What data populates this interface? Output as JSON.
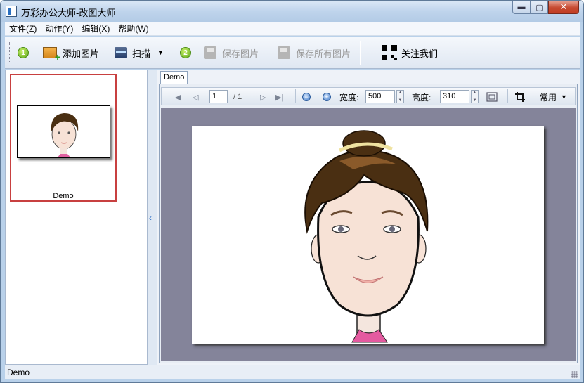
{
  "window": {
    "title": "万彩办公大师-改图大师",
    "buttons": {
      "minimize": "▬",
      "maximize": "▢",
      "close": "✕"
    }
  },
  "menu": {
    "items": [
      "文件(Z)",
      "动作(Y)",
      "编辑(X)",
      "帮助(W)"
    ]
  },
  "toolbar": {
    "step1": "1",
    "add_image": "添加图片",
    "scan": "扫描",
    "step2": "2",
    "save_image": "保存图片",
    "save_all": "保存所有图片",
    "follow_us": "关注我们"
  },
  "thumbnails": [
    {
      "label": "Demo",
      "selected": true
    }
  ],
  "tab": {
    "label": "Demo"
  },
  "viewer": {
    "page_current": "1",
    "page_total": "/ 1",
    "width_label": "宽度:",
    "width_value": "500",
    "height_label": "高度:",
    "height_value": "310",
    "preset_label": "常用"
  },
  "status": {
    "text": "Demo"
  },
  "colors": {
    "accent": "#2b6cc4",
    "selection": "#c84040",
    "canvas": "#84849a"
  }
}
